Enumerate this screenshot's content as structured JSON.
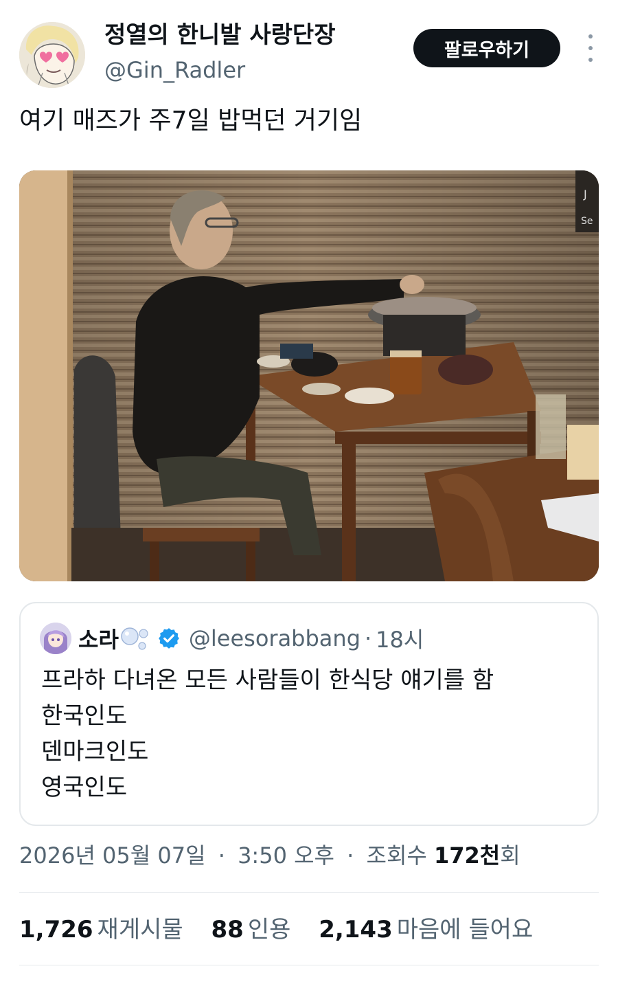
{
  "author": {
    "display_name": "정열의 한니발 사랑단장",
    "handle": "@Gin_Radler",
    "avatar_icon": "anime-portrait-avatar"
  },
  "follow_label": "팔로우하기",
  "more_icon": "more-vertical-icon",
  "tweet_text": "여기 매즈가 주7일 밥먹던 거기임",
  "media": {
    "description_icon": "restaurant-photo",
    "sign_text": "J\nSe"
  },
  "quote": {
    "name": "소라",
    "handle": "@leesorabbang",
    "separator": "·",
    "time": "18시",
    "verified_color": "#1d9bf0",
    "lines": [
      "프라하 다녀온 모든 사람들이 한식당 얘기를 함",
      "한국인도",
      "덴마크인도",
      "영국인도"
    ]
  },
  "meta": {
    "date": "2026년 05월 07일",
    "time": "3:50 오후",
    "views_prefix": "조회수",
    "views_value": "172천",
    "views_suffix": "회",
    "separator": "·"
  },
  "stats": {
    "retweets": {
      "count": "1,726",
      "label": "재게시물"
    },
    "quotes": {
      "count": "88",
      "label": "인용"
    },
    "likes": {
      "count": "2,143",
      "label": "마음에 들어요"
    }
  },
  "colors": {
    "text_primary": "#0f1419",
    "text_secondary": "#536471",
    "border": "#e4e8eb",
    "button_bg": "#0f1419"
  }
}
